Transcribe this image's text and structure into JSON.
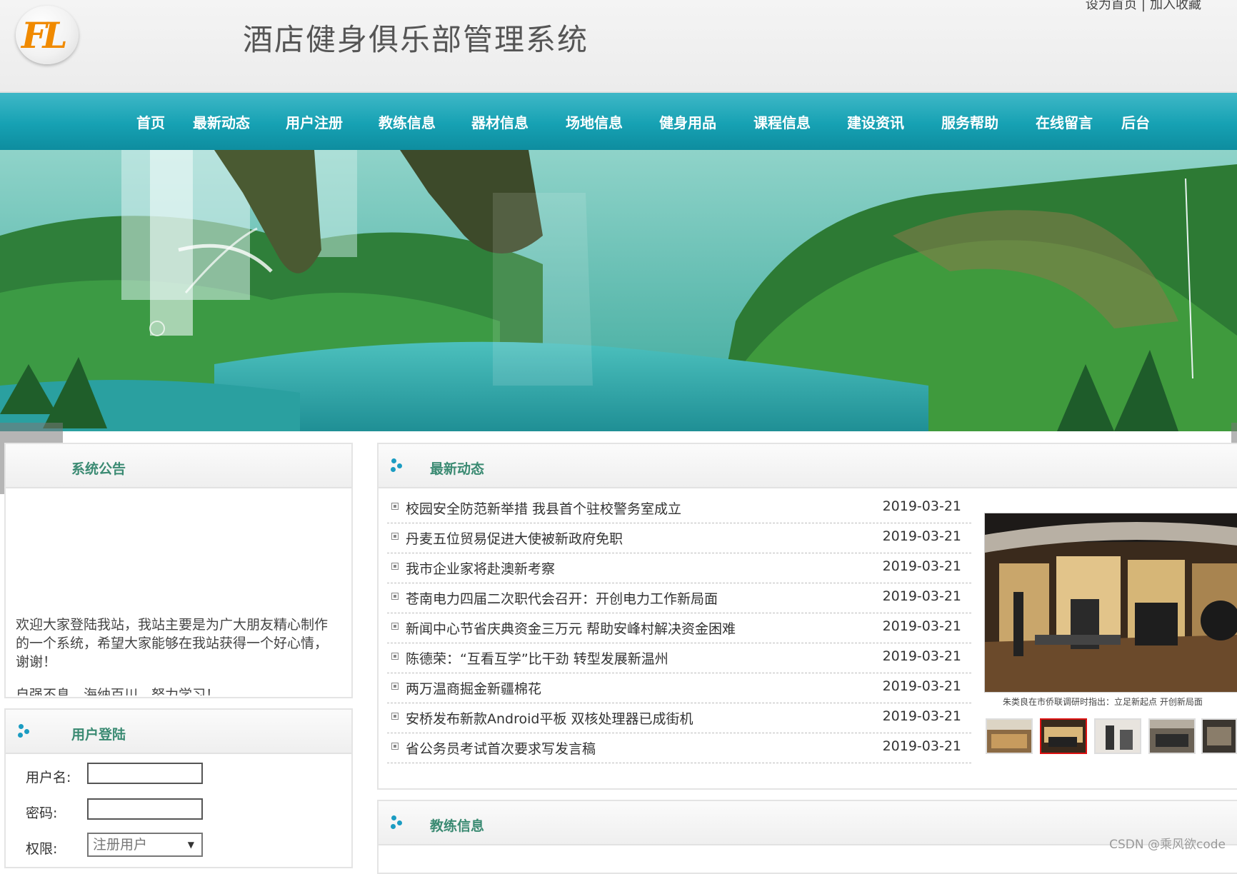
{
  "header": {
    "logo_text": "FL",
    "site_title": "酒店健身俱乐部管理系统",
    "top_links": [
      "设为首页",
      "加入收藏"
    ],
    "top_separator": "|"
  },
  "nav": {
    "items": [
      "首页",
      "最新动态",
      "用户注册",
      "教练信息",
      "器材信息",
      "场地信息",
      "健身用品",
      "课程信息",
      "建设资讯",
      "服务帮助",
      "在线留言",
      "后台"
    ]
  },
  "notice": {
    "title": "系统公告",
    "text": "欢迎大家登陆我站，我站主要是为广大朋友精心制作的一个系统，希望大家能够在我站获得一个好心情，谢谢！",
    "text2": "自强不息，海纳百川，努力学习！"
  },
  "login": {
    "title": "用户登陆",
    "username_label": "用户名:",
    "password_label": "密码:",
    "role_label": "权限:",
    "role_selected": "注册用户"
  },
  "news": {
    "title": "最新动态",
    "items": [
      {
        "title": "校园安全防范新举措 我县首个驻校警务室成立",
        "date": "2019-03-21"
      },
      {
        "title": "丹麦五位贸易促进大使被新政府免职",
        "date": "2019-03-21"
      },
      {
        "title": "我市企业家将赴澳新考察",
        "date": "2019-03-21"
      },
      {
        "title": "苍南电力四届二次职代会召开：开创电力工作新局面",
        "date": "2019-03-21"
      },
      {
        "title": "新闻中心节省庆典资金三万元 帮助安峰村解决资金困难",
        "date": "2019-03-21"
      },
      {
        "title": "陈德荣：“互看互学”比干劲 转型发展新温州",
        "date": "2019-03-21"
      },
      {
        "title": "两万温商掘金新疆棉花",
        "date": "2019-03-21"
      },
      {
        "title": "安桥发布新款Android平板 双核处理器已成街机",
        "date": "2019-03-21"
      },
      {
        "title": "省公务员考试首次要求写发言稿",
        "date": "2019-03-21"
      }
    ],
    "slide_caption": "朱类良在市侨联调研时指出：立足新起点 开创新局面"
  },
  "coach": {
    "title": "教练信息"
  },
  "watermark": "CSDN @乘风欲code"
}
